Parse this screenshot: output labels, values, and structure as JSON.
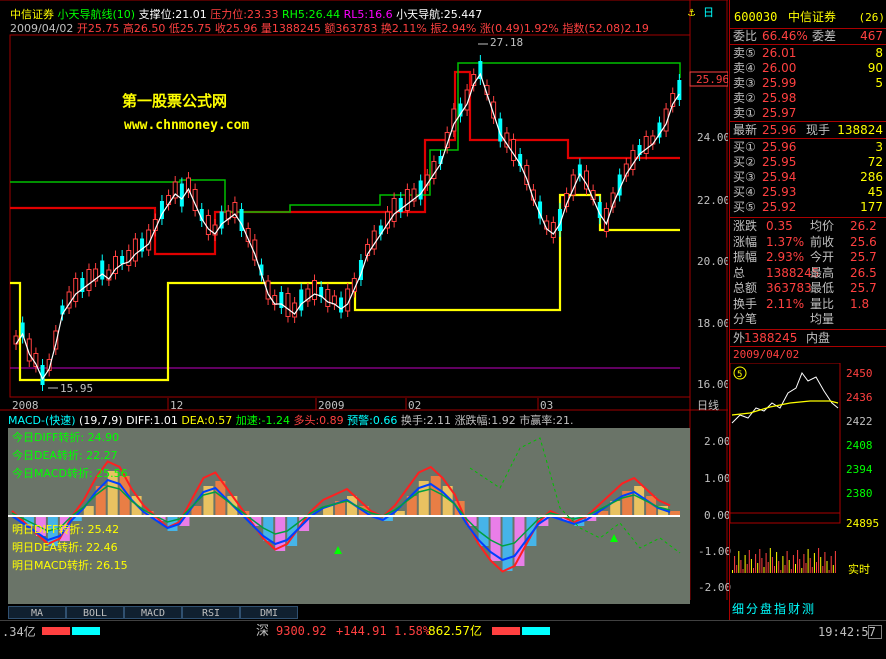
{
  "kline": {
    "stock_name": "中信证券",
    "indicator": "小天导航线(10)",
    "support": "支撑位:21.01",
    "pressure": "压力位:23.33",
    "rh5": "RH5:26.44",
    "rl5": "RL5:16.6",
    "nav": "小天导航:25.447",
    "date": "2009/04/02",
    "open": "开25.75",
    "high": "高26.50",
    "low": "低25.75",
    "close": "收25.96",
    "volume": "量1388245",
    "amount": "额363783",
    "turnover": "换2.11%",
    "amplitude": "振2.94%",
    "change": "涨(0.49)1.92%",
    "index": "指数(52.08)2.19",
    "high_mark": "27.18",
    "low_mark": "15.95",
    "last_price_tag": "25.96",
    "price_axis": [
      "24.00",
      "22.00",
      "20.00",
      "18.00",
      "16.00"
    ],
    "date_axis": [
      "2008",
      "12",
      "2009",
      "02",
      "03"
    ],
    "axis_mode": "日线",
    "watermark_1": "第一股票公式网",
    "watermark_2": "www.chnmoney.com"
  },
  "macd": {
    "title": "MACD-(快速)",
    "params": "(19,7,9)",
    "diff": "DIFF:1.01",
    "dea": "DEA:0.57",
    "accel": "加速:-1.24",
    "longs": "多头:0.89",
    "warn": "预警:0.66",
    "hand": "换手:2.11",
    "rise_fall": "涨跌幅:1.92",
    "pe": "市赢率:21.",
    "today_diff": "今日DIFF转折: 24.90",
    "today_dea": "今日DEA转折: 22.27",
    "today_macd": "今日MACD转折: 25.56",
    "tomorrow_diff": "明日DIFF转折: 25.42",
    "tomorrow_dea": "明日DEA转折: 22.46",
    "tomorrow_macd": "明日MACD转折: 26.15",
    "axis": [
      "2.00",
      "1.00",
      "0.00",
      "-1.00",
      "-2.00"
    ]
  },
  "tabs": [
    "MA",
    "BOLL",
    "MACD",
    "RSI",
    "DMI"
  ],
  "quote": {
    "code": "600030",
    "name": "中信证券",
    "badge": "(26)",
    "ratio_label": "委比",
    "ratio": "66.46%",
    "diff_label": "委差",
    "diff": "467",
    "sells": [
      {
        "label": "卖⑤",
        "price": "26.01",
        "vol": "8"
      },
      {
        "label": "卖④",
        "price": "26.00",
        "vol": "90"
      },
      {
        "label": "卖③",
        "price": "25.99",
        "vol": "5"
      },
      {
        "label": "卖②",
        "price": "25.98",
        "vol": ""
      },
      {
        "label": "卖①",
        "price": "25.97",
        "vol": ""
      }
    ],
    "last_label": "最新",
    "last": "25.96",
    "hand_label": "现手",
    "hand": "138824",
    "buys": [
      {
        "label": "买①",
        "price": "25.96",
        "vol": "3"
      },
      {
        "label": "买②",
        "price": "25.95",
        "vol": "72"
      },
      {
        "label": "买③",
        "price": "25.94",
        "vol": "286"
      },
      {
        "label": "买④",
        "price": "25.93",
        "vol": "45"
      },
      {
        "label": "买⑤",
        "price": "25.92",
        "vol": "177"
      }
    ],
    "stats": [
      {
        "l1": "涨跌",
        "v1": "0.35",
        "l2": "均价",
        "v2": "26.2"
      },
      {
        "l1": "涨幅",
        "v1": "1.37%",
        "l2": "前收",
        "v2": "25.6"
      },
      {
        "l1": "振幅",
        "v1": "2.93%",
        "l2": "今开",
        "v2": "25.7"
      },
      {
        "l1": "总",
        "v1": "1388245",
        "l2": "最高",
        "v2": "26.5"
      },
      {
        "l1": "总额",
        "v1": "363783",
        "l2": "最低",
        "v2": "25.7"
      },
      {
        "l1": "换手",
        "v1": "2.11%",
        "l2": "量比",
        "v2": "1.8"
      },
      {
        "l1": "分笔",
        "v1": "",
        "l2": "均量",
        "v2": ""
      }
    ],
    "outer_label": "外",
    "outer": "1388245",
    "inner_label": "内盘",
    "date": "2009/04/02",
    "mini_axis": [
      "2450",
      "2436",
      "2422",
      "2408",
      "2394",
      "2380"
    ],
    "mini_vol": "24895",
    "realtime": "实时",
    "bottom_tabs": "细分盘指财测"
  },
  "status": {
    "left": ".34亿",
    "market": "深",
    "index": "9300.92",
    "change": "+144.91",
    "pct": "1.58%",
    "amount": "862.57亿",
    "time": "19:42:57"
  }
}
